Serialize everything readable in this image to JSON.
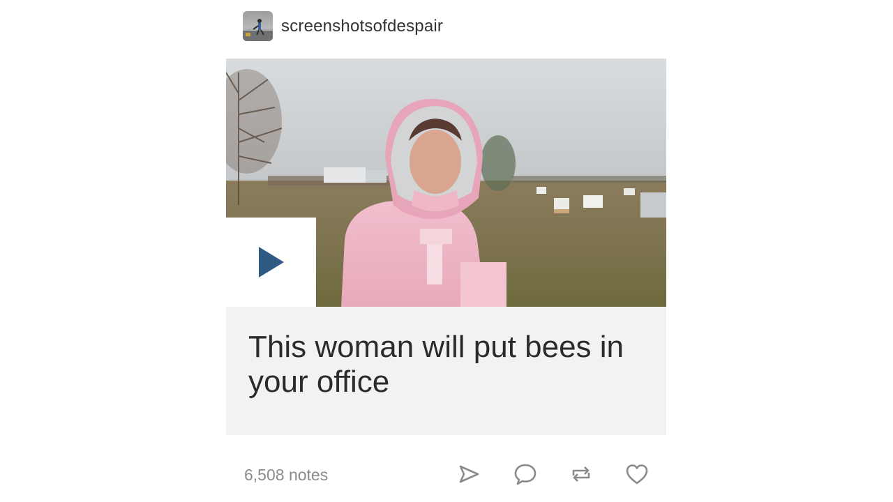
{
  "post": {
    "username": "screenshotsofdespair",
    "avatar_icon": "avatar-image",
    "caption": "This woman will put bees in your office",
    "notes": "6,508 notes"
  },
  "media": {
    "type": "video",
    "play_icon": "play-icon",
    "play_color": "#2e5a84"
  },
  "actions": [
    {
      "icon": "send-icon"
    },
    {
      "icon": "reply-icon"
    },
    {
      "icon": "reblog-icon"
    },
    {
      "icon": "heart-icon"
    }
  ]
}
